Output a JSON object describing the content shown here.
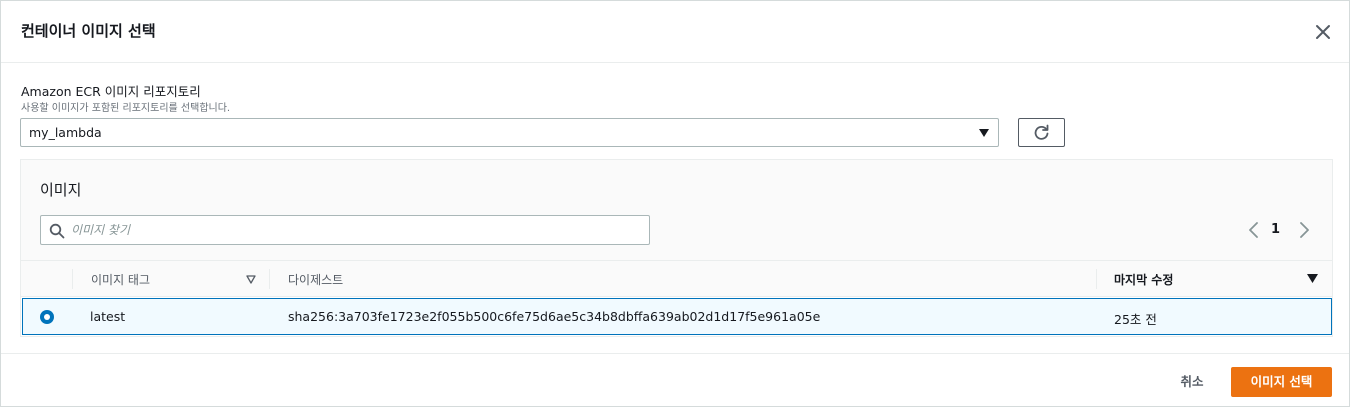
{
  "dialog": {
    "title": "컨테이너 이미지 선택",
    "close_icon": "close-icon"
  },
  "repository": {
    "label": "Amazon ECR 이미지 리포지토리",
    "description": "사용할 이미지가 포함된 리포지토리를 선택합니다.",
    "selected": "my_lambda",
    "refresh_icon": "refresh-icon"
  },
  "images": {
    "title": "이미지",
    "search_placeholder": "이미지 찾기",
    "search_value": "",
    "pagination": {
      "current_page": "1"
    },
    "columns": {
      "tag": "이미지 태그",
      "digest": "다이제스트",
      "modified": "마지막 수정"
    },
    "rows": [
      {
        "selected": true,
        "tag": "latest",
        "digest": "sha256:3a703fe1723e2f055b500c6fe75d6ae5c34b8dbffa639ab02d1d17f5e961a05e",
        "modified": "25초 전"
      }
    ]
  },
  "footer": {
    "cancel_label": "취소",
    "confirm_label": "이미지 선택"
  },
  "colors": {
    "primary": "#ec7211",
    "selection": "#0073bb",
    "selection_bg": "#f1faff"
  }
}
